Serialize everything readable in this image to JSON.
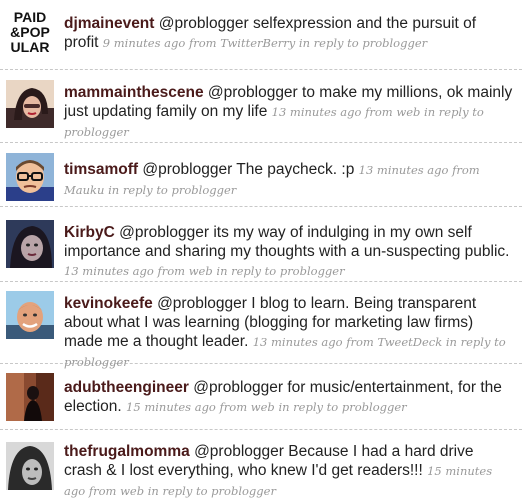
{
  "tweets": [
    {
      "author": "djmainevent",
      "avatar_icon": "paid-and-popular-logo",
      "avatar_text": [
        "PAID",
        "&POP",
        "ULAR"
      ],
      "mention": "@problogger",
      "text": "selfexpression and the pursuit of profit",
      "time": "9 minutes ago",
      "from_prefix": "from",
      "source": "TwitterBerry",
      "reply_prefix": "in reply to",
      "reply_to": "problogger"
    },
    {
      "author": "mammainthescene",
      "avatar_icon": "user-photo-avatar",
      "mention": "@problogger",
      "text": "to make my millions, ok mainly just updating family on my life",
      "time": "13 minutes ago",
      "from_prefix": "from",
      "source": "web",
      "reply_prefix": "in reply to",
      "reply_to": "problogger"
    },
    {
      "author": "timsamoff",
      "avatar_icon": "user-photo-avatar",
      "mention": "@problogger",
      "text": "The paycheck. :p",
      "time": "13 minutes ago",
      "from_prefix": "from",
      "source": "Mauku",
      "reply_prefix": "in reply to",
      "reply_to": "problogger"
    },
    {
      "author": "KirbyC",
      "avatar_icon": "user-photo-avatar",
      "mention": "@problogger",
      "text": "its my way of indulging in my own self importance and sharing my thoughts with a un-suspecting public.",
      "time": "13 minutes ago",
      "from_prefix": "from",
      "source": "web",
      "reply_prefix": "in reply to",
      "reply_to": "problogger"
    },
    {
      "author": "kevinokeefe",
      "avatar_icon": "user-photo-avatar",
      "mention": "@problogger",
      "text": "I blog to learn. Being transparent about what I was learning (blogging for marketing law firms) made me a thought leader.",
      "time": "13 minutes ago",
      "from_prefix": "from",
      "source": "TweetDeck",
      "reply_prefix": "in reply to",
      "reply_to": "problogger"
    },
    {
      "author": "adubtheengineer",
      "avatar_icon": "user-photo-avatar",
      "mention": "@problogger",
      "text": "for music/entertainment, for the election.",
      "time": "15 minutes ago",
      "from_prefix": "from",
      "source": "web",
      "reply_prefix": "in reply to",
      "reply_to": "problogger"
    },
    {
      "author": "thefrugalmomma",
      "avatar_icon": "user-photo-avatar",
      "mention": "@problogger",
      "text": "Because I had a hard drive crash & I lost everything, who knew I'd get readers!!!",
      "time": "15 minutes ago",
      "from_prefix": "from",
      "source": "web",
      "reply_prefix": "in reply to",
      "reply_to": "problogger"
    }
  ]
}
